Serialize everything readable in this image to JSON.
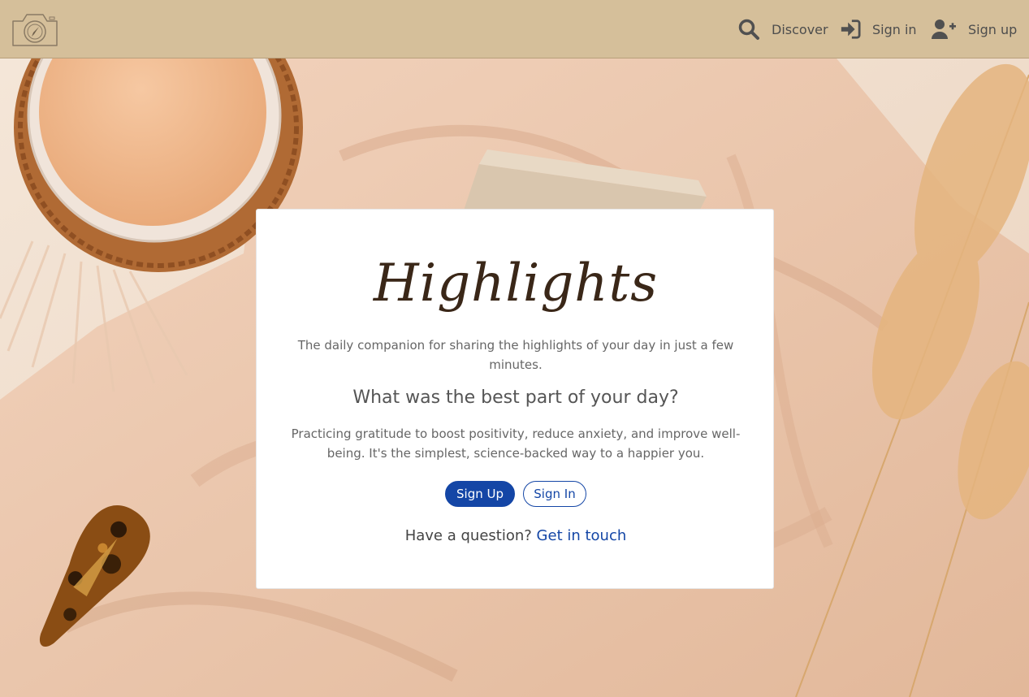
{
  "navbar": {
    "logo_icon": "camera-compass-icon",
    "items": [
      {
        "icon": "search-icon",
        "label": "Discover"
      },
      {
        "icon": "sign-in-icon",
        "label": "Sign in"
      },
      {
        "icon": "user-plus-icon",
        "label": "Sign up"
      }
    ]
  },
  "card": {
    "brand": "Highlights",
    "tagline": "The daily companion for sharing the highlights of your day in just a few minutes.",
    "question": "What was the best part of your day?",
    "description": "Practicing gratitude to boost positivity, reduce anxiety, and improve well-being. It's the simplest, science-backed way to a happier you.",
    "signup_button": "Sign Up",
    "signin_button": "Sign In",
    "contact_prefix": "Have a question?",
    "contact_link": "Get in touch"
  },
  "colors": {
    "navbar_bg": "#d5bf9a",
    "primary": "#1446a6",
    "brand_text": "#3a2718"
  }
}
